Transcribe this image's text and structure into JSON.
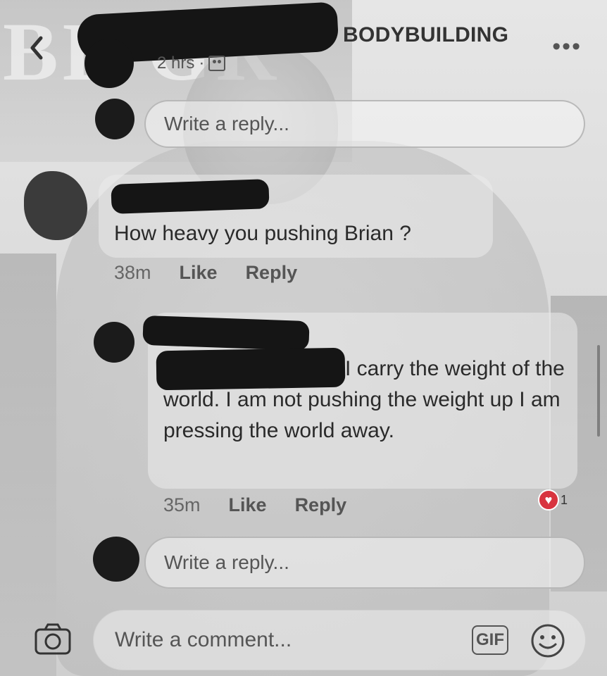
{
  "header": {
    "group_name": "BODYBUILDING",
    "post_time": "2 hrs",
    "meta_separator": "·",
    "back_icon": "chevron-left-icon",
    "more_icon": "more-horizontal-icon"
  },
  "reply_top": {
    "placeholder": "Write a reply..."
  },
  "comments": [
    {
      "text": "How heavy you pushing Brian ?",
      "time": "38m",
      "like_label": "Like",
      "reply_label": "Reply"
    },
    {
      "text": "I carry the weight of the world. I am not pushing the weight up I am pressing the world away.",
      "time": "35m",
      "like_label": "Like",
      "reply_label": "Reply",
      "reaction_count": "1",
      "reaction_color": "#d8343f"
    }
  ],
  "reply_bottom": {
    "placeholder": "Write a reply..."
  },
  "composer": {
    "placeholder": "Write a comment...",
    "gif_label": "GIF",
    "camera_icon": "camera-icon",
    "emoji_icon": "smiley-icon"
  }
}
